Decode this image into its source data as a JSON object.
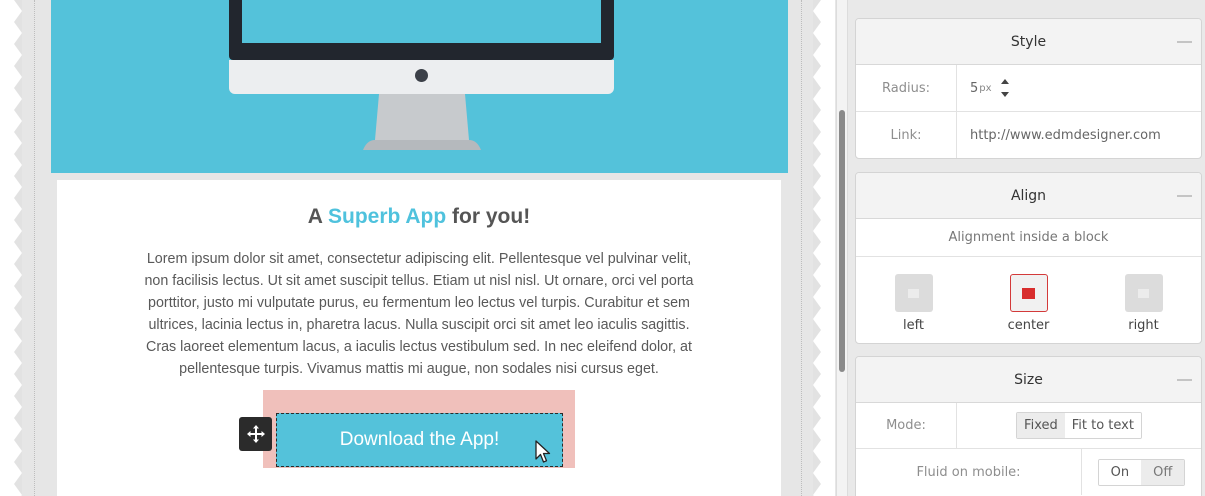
{
  "canvas": {
    "headline_prefix": "A ",
    "headline_accent": "Superb App",
    "headline_suffix": " for you!",
    "body_lines": [
      "Lorem ipsum dolor sit amet, consectetur adipiscing elit. Pellentesque vel pulvinar velit,",
      "non facilisis lectus. Ut sit amet suscipit tellus. Etiam ut nisl nisl. Ut ornare, orci vel porta",
      "porttitor, justo mi vulputate purus, eu fermentum leo lectus vel turpis. Curabitur et sem",
      "ultrices, lacinia lectus in, pharetra lacus. Nulla suscipit orci sit amet leo iaculis sagittis.",
      "Cras laoreet elementum lacus, a iaculis lectus vestibulum sed. In nec eleifend dolor, at",
      "pellentesque turpis. Vivamus mattis mi augue, non sodales nisi cursus eget."
    ],
    "button_label": "Download the App!",
    "colors": {
      "hero_bg": "#54c2da",
      "accent": "#4fc2dd",
      "button_bg": "#54c2da",
      "highlight": "#f0c0bb"
    }
  },
  "panel": {
    "style": {
      "title": "Style",
      "radius_label": "Radius:",
      "radius_value": "5",
      "radius_unit": "px",
      "link_label": "Link:",
      "link_value": "http://www.edmdesigner.com"
    },
    "align": {
      "title": "Align",
      "description": "Alignment inside a block",
      "options": [
        "left",
        "center",
        "right"
      ],
      "selected": "center",
      "selected_color": "#d82d2d"
    },
    "size": {
      "title": "Size",
      "mode_label": "Mode:",
      "mode_options": [
        "Fixed",
        "Fit to text"
      ],
      "mode_selected": "Fixed",
      "fluid_label": "Fluid on mobile:",
      "fluid_options": [
        "On",
        "Off"
      ],
      "fluid_selected": "Off"
    }
  }
}
